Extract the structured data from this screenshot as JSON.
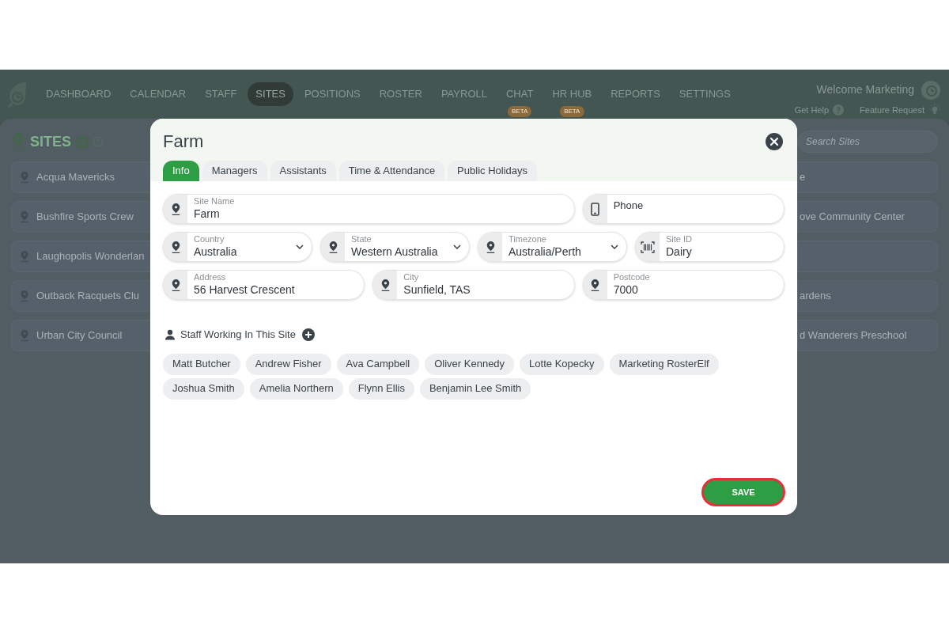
{
  "nav": {
    "items": [
      {
        "label": "DASHBOARD",
        "selected": false
      },
      {
        "label": "CALENDAR",
        "selected": false
      },
      {
        "label": "STAFF",
        "selected": false
      },
      {
        "label": "SITES",
        "selected": true
      },
      {
        "label": "POSITIONS",
        "selected": false
      },
      {
        "label": "ROSTER",
        "selected": false
      },
      {
        "label": "PAYROLL",
        "selected": false
      },
      {
        "label": "CHAT",
        "selected": false,
        "badge": "BETA"
      },
      {
        "label": "HR HUB",
        "selected": false,
        "badge": "BETA"
      },
      {
        "label": "REPORTS",
        "selected": false
      },
      {
        "label": "SETTINGS",
        "selected": false
      }
    ],
    "welcome": "Welcome Marketing",
    "links": [
      {
        "label": "Get Help",
        "kind": "help"
      },
      {
        "label": "Feature Request",
        "kind": "idea"
      }
    ]
  },
  "sites_panel": {
    "title": "SITES",
    "search": {
      "placeholder": "Search Sites"
    },
    "left_items": [
      {
        "label": "Acqua Mavericks"
      },
      {
        "label": "Bushfire Sports Crew"
      },
      {
        "label": "Laughopolis Wonderlan"
      },
      {
        "label": "Outback Racquets Clu"
      },
      {
        "label": "Urban City Council"
      }
    ],
    "right_items": [
      {
        "label": "e"
      },
      {
        "label": "ove Community Center"
      },
      {
        "label": "ardens"
      },
      {
        "label": "d Wanderers Preschool"
      }
    ]
  },
  "modal": {
    "title": "Farm",
    "tabs": [
      {
        "label": "Info",
        "selected": true
      },
      {
        "label": "Managers",
        "selected": false
      },
      {
        "label": "Assistants",
        "selected": false
      },
      {
        "label": "Time & Attendance",
        "selected": false
      },
      {
        "label": "Public Holidays",
        "selected": false
      }
    ],
    "rows": [
      [
        {
          "kind": "text",
          "label": "Site Name",
          "value": "Farm"
        },
        {
          "kind": "text",
          "placeholder": "Phone"
        }
      ],
      [
        {
          "kind": "select",
          "label": "Country",
          "value": "Australia"
        },
        {
          "kind": "select",
          "label": "State",
          "value": "Western Australia"
        },
        {
          "kind": "select",
          "label": "Timezone",
          "value": "Australia/Perth"
        },
        {
          "kind": "text",
          "label": "Site ID",
          "value": "Dairy"
        }
      ],
      [
        {
          "kind": "text",
          "label": "Address",
          "value": "56 Harvest Crescent"
        },
        {
          "kind": "text",
          "label": "City",
          "value": "Sunfield, TAS"
        },
        {
          "kind": "text",
          "label": "Postcode",
          "value": "7000"
        }
      ]
    ],
    "staff": {
      "heading": "Staff Working In This Site",
      "members": [
        "Matt Butcher",
        "Andrew Fisher",
        "Ava Campbell",
        "Oliver Kennedy",
        "Lotte Kopecky",
        "Marketing RosterElf",
        "Joshua Smith",
        "Amelia Northern",
        "Flynn Ellis",
        "Benjamin Lee Smith"
      ]
    },
    "save": {
      "label": "SAVE",
      "highlighted": true
    }
  }
}
